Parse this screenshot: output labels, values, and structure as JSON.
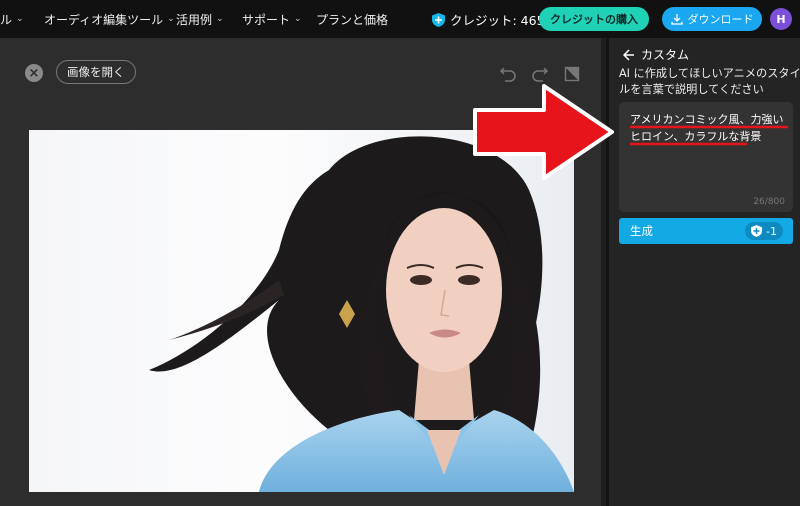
{
  "nav": {
    "items": [
      {
        "label": "ル"
      },
      {
        "label": "オーディオ編集ツール"
      },
      {
        "label": "活用例"
      },
      {
        "label": "サポート"
      },
      {
        "label": "プランと価格"
      }
    ],
    "credits": "クレジット: 465",
    "buy_label": "クレジットの購入",
    "download_label": "ダウンロード",
    "avatar_initial": "H"
  },
  "editor": {
    "open_image_label": "画像を開く"
  },
  "panel": {
    "back_label": "カスタム",
    "instruction": "AI に作成してほしいアニメのスタイルを言葉で説明してください",
    "prompt_text": "アメリカンコミック風、力強いヒロイン、カラフルな背景",
    "counter": "26/800",
    "generate_label": "生成",
    "cost": "-1"
  },
  "colors": {
    "accent_teal": "#1fd1b5",
    "accent_blue": "#1aa7f0",
    "generate_blue": "#12a9e5",
    "annotation_red": "#e8141c"
  }
}
